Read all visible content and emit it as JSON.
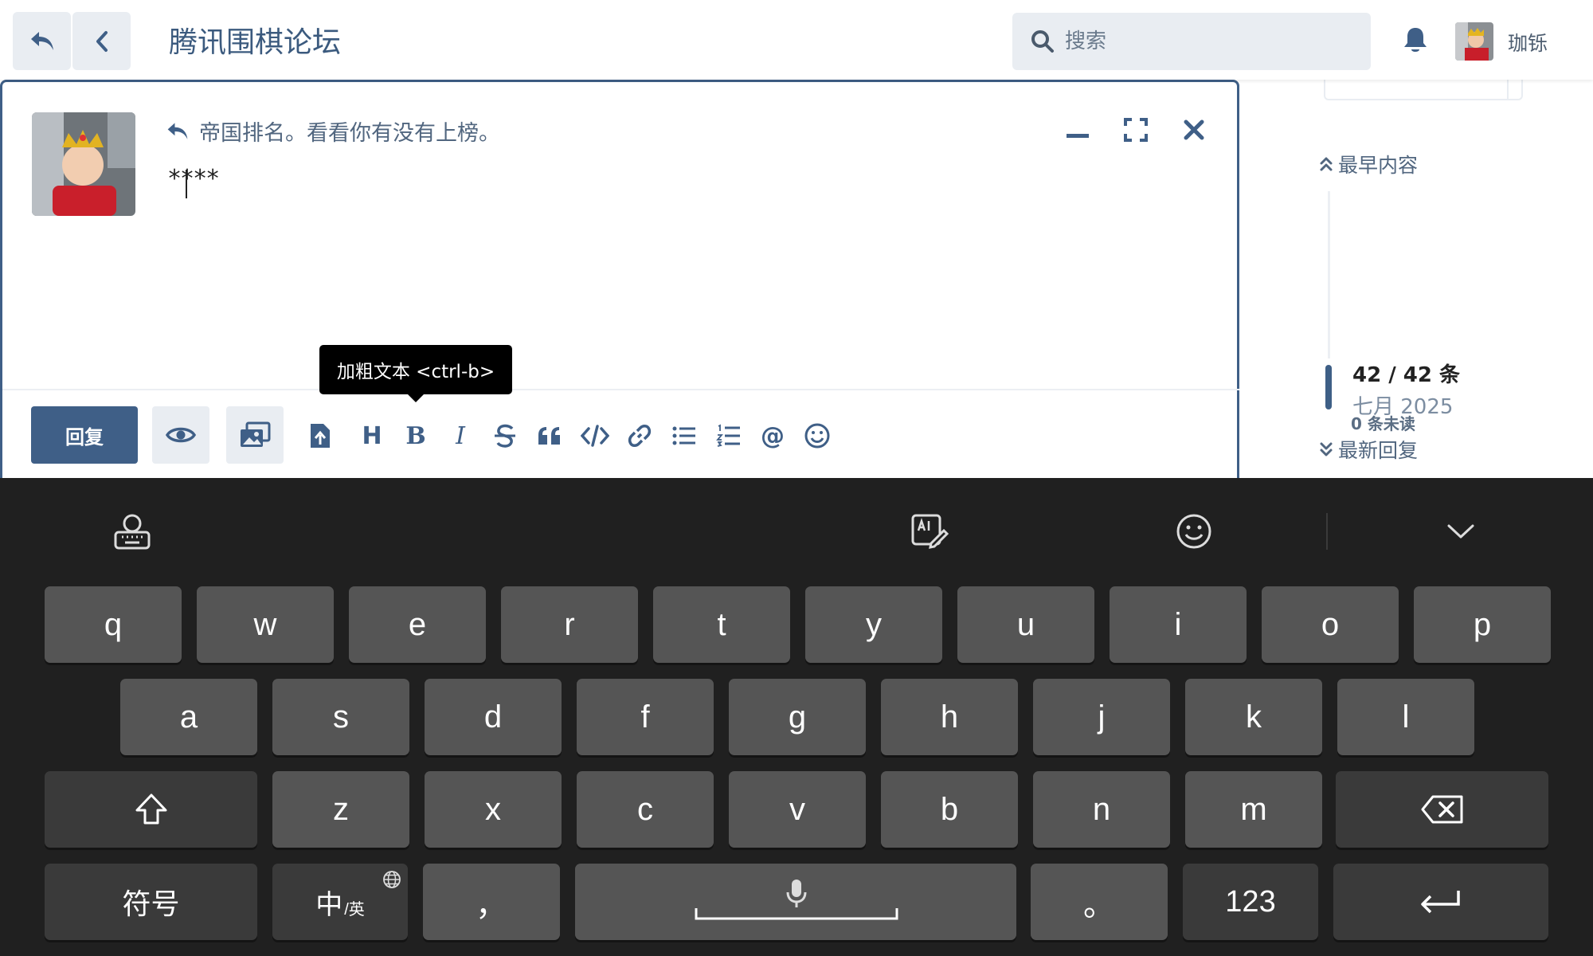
{
  "header": {
    "site_title": "腾讯围棋论坛",
    "search_placeholder": "搜索",
    "username": "珈铄"
  },
  "composer": {
    "reply_to": "帝国排名。看看你有没有上榜。",
    "editor_text": "****",
    "tooltip": "加粗文本 <ctrl-b>",
    "reply_button": "回复",
    "toolbar_icons": [
      "upload-icon",
      "heading-icon",
      "bold-icon",
      "italic-icon",
      "strikethrough-icon",
      "quote-icon",
      "code-icon",
      "link-icon",
      "bullet-list-icon",
      "numbered-list-icon",
      "mention-icon",
      "emoji-icon"
    ],
    "heading_glyph": "H",
    "bold_glyph": "B",
    "italic_glyph": "I",
    "mention_glyph": "@"
  },
  "timeline": {
    "top_label": "最早内容",
    "position": "42 / 42 条",
    "date": "七月 2025",
    "unread": "0 条未读",
    "bottom_label": "最新回复"
  },
  "keyboard": {
    "row1": [
      "q",
      "w",
      "e",
      "r",
      "t",
      "y",
      "u",
      "i",
      "o",
      "p"
    ],
    "row2": [
      "a",
      "s",
      "d",
      "f",
      "g",
      "h",
      "j",
      "k",
      "l"
    ],
    "row3": [
      "z",
      "x",
      "c",
      "v",
      "b",
      "n",
      "m"
    ],
    "symbols_label": "符号",
    "lang_main": "中",
    "lang_sub": "/英",
    "comma": "，",
    "period": "。",
    "numbers_label": "123"
  },
  "colors": {
    "accent": "#3f5f87",
    "keyboard_bg": "#202020",
    "key_bg": "#555555",
    "key_dark_bg": "#3a3a3a"
  }
}
